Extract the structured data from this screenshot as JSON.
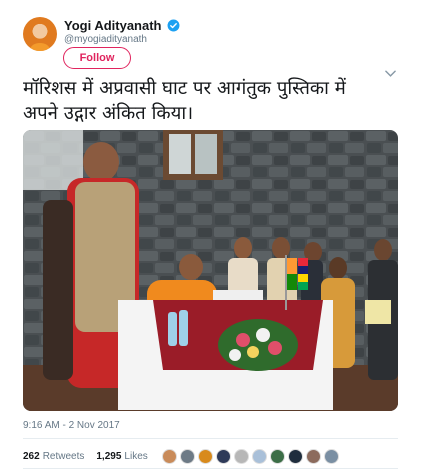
{
  "tweet": {
    "author": {
      "display_name": "Yogi Adityanath",
      "handle": "@myogiadityanath",
      "verified": true
    },
    "follow_label": "Follow",
    "text_line1": "मॉरिशस में अप्रवासी घाट पर आगंतुक पुस्तिका में",
    "text_line2": "अपने उद्गार अंकित किया।",
    "timestamp": "9:16 AM - 2 Nov 2017",
    "stats": {
      "retweets_count": "262",
      "retweets_label": "Retweets",
      "likes_count": "1,295",
      "likes_label": "Likes"
    },
    "liker_avatar_colors": [
      "#c98b5a",
      "#6d7a86",
      "#d88a1c",
      "#2e3a59",
      "#b7b7b7",
      "#a9c0d9",
      "#3c6e47",
      "#1f2d3d",
      "#8c6b5d",
      "#7a8fa3"
    ]
  },
  "colors": {
    "follow_accent": "#e0245e",
    "verified_blue": "#1da1f2",
    "secondary_text": "#657786"
  }
}
